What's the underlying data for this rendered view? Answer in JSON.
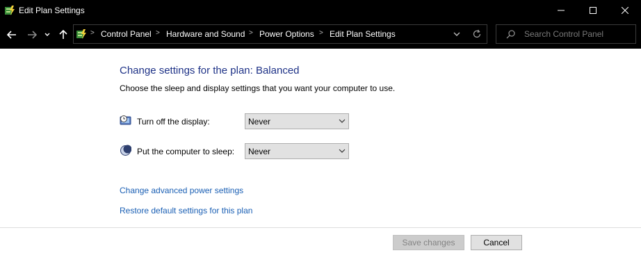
{
  "window": {
    "title": "Edit Plan Settings"
  },
  "breadcrumbs": [
    "Control Panel",
    "Hardware and Sound",
    "Power Options",
    "Edit Plan Settings"
  ],
  "search": {
    "placeholder": "Search Control Panel"
  },
  "content": {
    "heading": "Change settings for the plan: Balanced",
    "subtext": "Choose the sleep and display settings that you want your computer to use.",
    "display_label": "Turn off the display:",
    "display_value": "Never",
    "sleep_label": "Put the computer to sleep:",
    "sleep_value": "Never",
    "advanced_link": "Change advanced power settings",
    "restore_link": "Restore default settings for this plan"
  },
  "buttons": {
    "save": "Save changes",
    "cancel": "Cancel"
  },
  "icons": [
    "power-options-icon",
    "minimize-icon",
    "maximize-icon",
    "close-icon",
    "back-arrow-icon",
    "forward-arrow-icon",
    "recent-locations-icon",
    "up-arrow-icon",
    "control-panel-icon",
    "address-dropdown-icon",
    "refresh-icon",
    "search-icon",
    "display-icon",
    "sleep-moon-icon"
  ]
}
